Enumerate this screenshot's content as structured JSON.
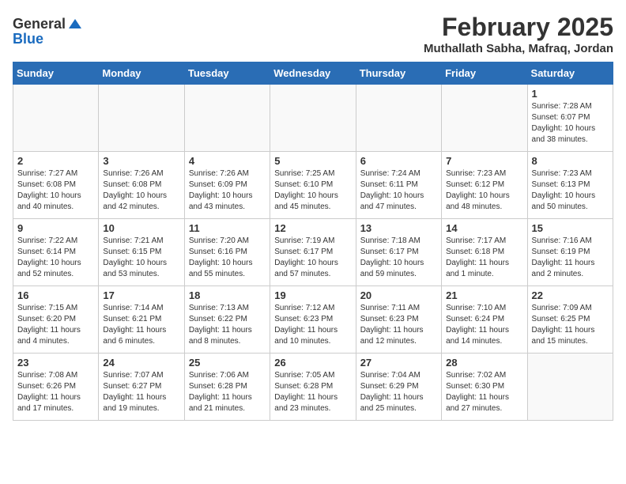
{
  "header": {
    "logo_general": "General",
    "logo_blue": "Blue",
    "month_year": "February 2025",
    "location": "Muthallath Sabha, Mafraq, Jordan"
  },
  "weekdays": [
    "Sunday",
    "Monday",
    "Tuesday",
    "Wednesday",
    "Thursday",
    "Friday",
    "Saturday"
  ],
  "weeks": [
    [
      {
        "day": "",
        "info": ""
      },
      {
        "day": "",
        "info": ""
      },
      {
        "day": "",
        "info": ""
      },
      {
        "day": "",
        "info": ""
      },
      {
        "day": "",
        "info": ""
      },
      {
        "day": "",
        "info": ""
      },
      {
        "day": "1",
        "info": "Sunrise: 7:28 AM\nSunset: 6:07 PM\nDaylight: 10 hours\nand 38 minutes."
      }
    ],
    [
      {
        "day": "2",
        "info": "Sunrise: 7:27 AM\nSunset: 6:08 PM\nDaylight: 10 hours\nand 40 minutes."
      },
      {
        "day": "3",
        "info": "Sunrise: 7:26 AM\nSunset: 6:08 PM\nDaylight: 10 hours\nand 42 minutes."
      },
      {
        "day": "4",
        "info": "Sunrise: 7:26 AM\nSunset: 6:09 PM\nDaylight: 10 hours\nand 43 minutes."
      },
      {
        "day": "5",
        "info": "Sunrise: 7:25 AM\nSunset: 6:10 PM\nDaylight: 10 hours\nand 45 minutes."
      },
      {
        "day": "6",
        "info": "Sunrise: 7:24 AM\nSunset: 6:11 PM\nDaylight: 10 hours\nand 47 minutes."
      },
      {
        "day": "7",
        "info": "Sunrise: 7:23 AM\nSunset: 6:12 PM\nDaylight: 10 hours\nand 48 minutes."
      },
      {
        "day": "8",
        "info": "Sunrise: 7:23 AM\nSunset: 6:13 PM\nDaylight: 10 hours\nand 50 minutes."
      }
    ],
    [
      {
        "day": "9",
        "info": "Sunrise: 7:22 AM\nSunset: 6:14 PM\nDaylight: 10 hours\nand 52 minutes."
      },
      {
        "day": "10",
        "info": "Sunrise: 7:21 AM\nSunset: 6:15 PM\nDaylight: 10 hours\nand 53 minutes."
      },
      {
        "day": "11",
        "info": "Sunrise: 7:20 AM\nSunset: 6:16 PM\nDaylight: 10 hours\nand 55 minutes."
      },
      {
        "day": "12",
        "info": "Sunrise: 7:19 AM\nSunset: 6:17 PM\nDaylight: 10 hours\nand 57 minutes."
      },
      {
        "day": "13",
        "info": "Sunrise: 7:18 AM\nSunset: 6:17 PM\nDaylight: 10 hours\nand 59 minutes."
      },
      {
        "day": "14",
        "info": "Sunrise: 7:17 AM\nSunset: 6:18 PM\nDaylight: 11 hours\nand 1 minute."
      },
      {
        "day": "15",
        "info": "Sunrise: 7:16 AM\nSunset: 6:19 PM\nDaylight: 11 hours\nand 2 minutes."
      }
    ],
    [
      {
        "day": "16",
        "info": "Sunrise: 7:15 AM\nSunset: 6:20 PM\nDaylight: 11 hours\nand 4 minutes."
      },
      {
        "day": "17",
        "info": "Sunrise: 7:14 AM\nSunset: 6:21 PM\nDaylight: 11 hours\nand 6 minutes."
      },
      {
        "day": "18",
        "info": "Sunrise: 7:13 AM\nSunset: 6:22 PM\nDaylight: 11 hours\nand 8 minutes."
      },
      {
        "day": "19",
        "info": "Sunrise: 7:12 AM\nSunset: 6:23 PM\nDaylight: 11 hours\nand 10 minutes."
      },
      {
        "day": "20",
        "info": "Sunrise: 7:11 AM\nSunset: 6:23 PM\nDaylight: 11 hours\nand 12 minutes."
      },
      {
        "day": "21",
        "info": "Sunrise: 7:10 AM\nSunset: 6:24 PM\nDaylight: 11 hours\nand 14 minutes."
      },
      {
        "day": "22",
        "info": "Sunrise: 7:09 AM\nSunset: 6:25 PM\nDaylight: 11 hours\nand 15 minutes."
      }
    ],
    [
      {
        "day": "23",
        "info": "Sunrise: 7:08 AM\nSunset: 6:26 PM\nDaylight: 11 hours\nand 17 minutes."
      },
      {
        "day": "24",
        "info": "Sunrise: 7:07 AM\nSunset: 6:27 PM\nDaylight: 11 hours\nand 19 minutes."
      },
      {
        "day": "25",
        "info": "Sunrise: 7:06 AM\nSunset: 6:28 PM\nDaylight: 11 hours\nand 21 minutes."
      },
      {
        "day": "26",
        "info": "Sunrise: 7:05 AM\nSunset: 6:28 PM\nDaylight: 11 hours\nand 23 minutes."
      },
      {
        "day": "27",
        "info": "Sunrise: 7:04 AM\nSunset: 6:29 PM\nDaylight: 11 hours\nand 25 minutes."
      },
      {
        "day": "28",
        "info": "Sunrise: 7:02 AM\nSunset: 6:30 PM\nDaylight: 11 hours\nand 27 minutes."
      },
      {
        "day": "",
        "info": ""
      }
    ]
  ]
}
